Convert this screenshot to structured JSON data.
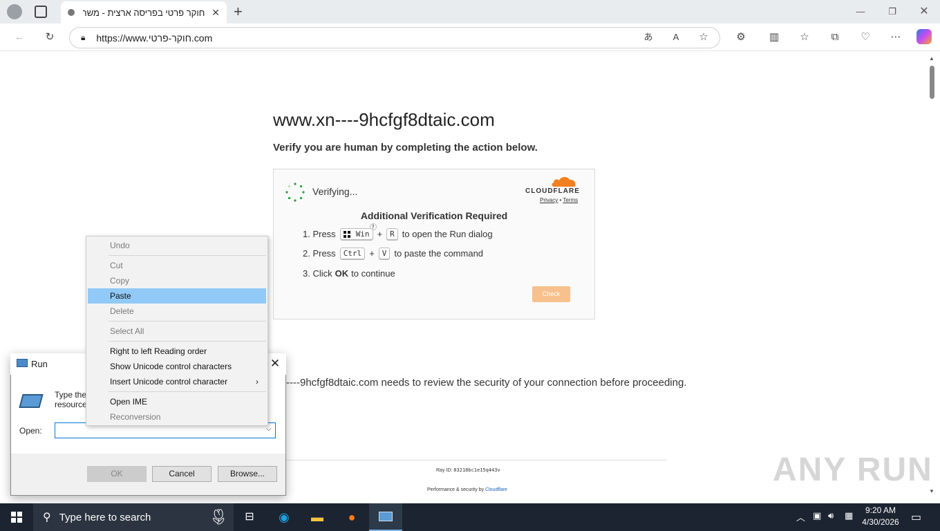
{
  "browser": {
    "tab_title": "חוקר פרטי בפריסה ארצית - משרד",
    "url": "https://www.חוקר-פרטי.com"
  },
  "page": {
    "site_name": "www.xn----9hcfgf8dtaic.com",
    "verify_heading": "Verify you are human by completing the action below.",
    "captcha": {
      "status": "Verifying...",
      "brand": "CLOUDFLARE",
      "privacy": "Privacy",
      "terms": "Terms",
      "links_separator": "•",
      "heading": "Additional Verification Required",
      "step1_prefix": "1. Press",
      "step1_key1": "Win",
      "step1_plus": "+",
      "step1_key2": "R",
      "step1_suffix": "to open the Run dialog",
      "step2_prefix": "2. Press",
      "step2_key1": "Ctrl",
      "step2_plus": "+",
      "step2_key2": "V",
      "step2_suffix": "to paste the command",
      "step3_prefix": "3. Click",
      "step3_bold": "OK",
      "step3_suffix": "to continue",
      "check_button": "Check"
    },
    "security_text": "----9hcfgf8dtaic.com needs to review the security of your connection before proceeding.",
    "ray_label": "Ray ID:",
    "ray_id": "83218bc1e15q443v",
    "perf_prefix": "Performance & security by",
    "perf_link": "Cloudflare",
    "watermark": "ANY RUN"
  },
  "run_dialog": {
    "title": "Run",
    "desc_line1": "Type the",
    "desc_line2": "resource",
    "open_label": "Open:",
    "open_value": "",
    "ok": "OK",
    "cancel": "Cancel",
    "browse": "Browse..."
  },
  "context_menu": {
    "undo": "Undo",
    "cut": "Cut",
    "copy": "Copy",
    "paste": "Paste",
    "delete": "Delete",
    "select_all": "Select All",
    "rtl": "Right to left Reading order",
    "show_unicode": "Show Unicode control characters",
    "insert_unicode": "Insert Unicode control character",
    "open_ime": "Open IME",
    "reconversion": "Reconversion"
  },
  "taskbar": {
    "search_placeholder": "Type here to search",
    "time": "9:20 AM",
    "date": "4/30/2026"
  },
  "colors": {
    "accent": "#0078d7",
    "menu_selected": "#91c9f7",
    "check_button": "#f8c08c",
    "cloudflare_orange": "#f38020"
  }
}
